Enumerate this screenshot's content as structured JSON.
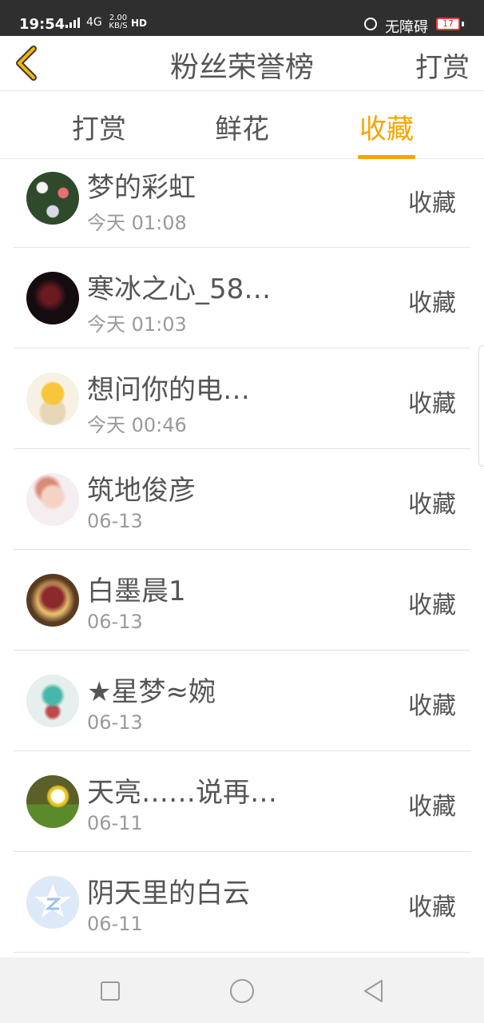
{
  "status_bar": {
    "time": "19:54",
    "network": "4G",
    "speed_value": "2.00",
    "speed_unit": "KB/S",
    "hd": "HD",
    "accessibility_label": "无障碍",
    "battery_level": "17",
    "battery_color": "#e33333"
  },
  "header": {
    "back_icon": "chevron-left-icon",
    "title": "粉丝荣誉榜",
    "right_action": "打赏"
  },
  "tabs": [
    {
      "label": "打赏",
      "active": false
    },
    {
      "label": "鲜花",
      "active": false
    },
    {
      "label": "收藏",
      "active": true
    }
  ],
  "accent_color": "#f5a500",
  "fans": [
    {
      "name": "梦的彩虹",
      "time": "今天 01:08",
      "action": "收藏"
    },
    {
      "name": "寒冰之心_58…",
      "time": "今天 01:03",
      "action": "收藏"
    },
    {
      "name": "想问你的电…",
      "time": "今天 00:46",
      "action": "收藏"
    },
    {
      "name": "筑地俊彦",
      "time": "06-13",
      "action": "收藏"
    },
    {
      "name": "白墨晨1",
      "time": "06-13",
      "action": "收藏"
    },
    {
      "name": "★星梦≈婉",
      "time": "06-13",
      "action": "收藏"
    },
    {
      "name": "天亮……说再…",
      "time": "06-11",
      "action": "收藏"
    },
    {
      "name": "阴天里的白云",
      "time": "06-11",
      "action": "收藏"
    }
  ],
  "navbar": {
    "recents_icon": "square-icon",
    "home_icon": "circle-icon",
    "back_icon": "triangle-back-icon"
  }
}
